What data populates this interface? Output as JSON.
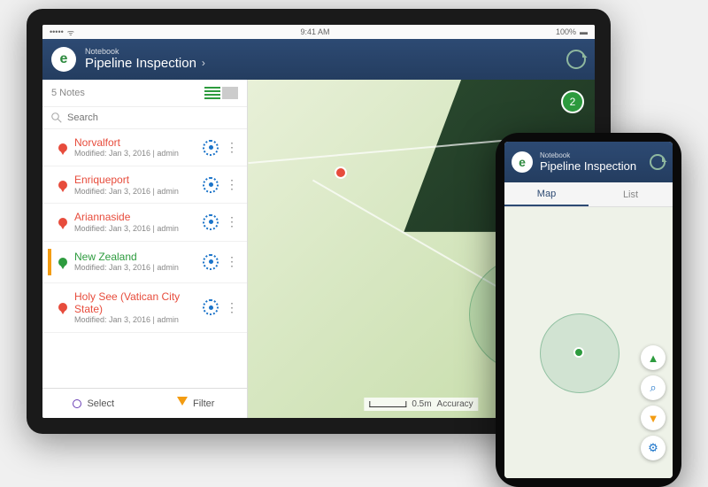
{
  "statusbar": {
    "time": "9:41 AM",
    "battery": "100%"
  },
  "header": {
    "notebook_label": "Notebook",
    "title": "Pipeline Inspection"
  },
  "sidebar": {
    "notes_count": "5 Notes",
    "search_placeholder": "Search",
    "items": [
      {
        "title": "Norvalfort",
        "meta": "Modified: Jan 3, 2016 | admin",
        "color": "#e74c3c",
        "bar": false
      },
      {
        "title": "Enriqueport",
        "meta": "Modified: Jan 3, 2016 | admin",
        "color": "#e74c3c",
        "bar": false
      },
      {
        "title": "Ariannaside",
        "meta": "Modified: Jan 3, 2016 | admin",
        "color": "#e74c3c",
        "bar": false
      },
      {
        "title": "New Zealand",
        "meta": "Modified: Jan 3, 2016 | admin",
        "color": "#2d9b3e",
        "bar": true
      },
      {
        "title": "Holy See (Vatican City State)",
        "meta": "Modified: Jan 3, 2016 | admin",
        "color": "#e74c3c",
        "bar": false
      }
    ],
    "footer": {
      "select": "Select",
      "filter": "Filter"
    }
  },
  "map": {
    "badge": "2",
    "scale": "0.5m",
    "accuracy": "Accuracy"
  },
  "phone": {
    "header": {
      "notebook_label": "Notebook",
      "title": "Pipeline Inspection"
    },
    "tabs": {
      "map": "Map",
      "list": "List"
    }
  },
  "colors": {
    "red": "#e74c3c",
    "orange": "#f39c12",
    "green": "#2d9b3e",
    "blue": "#1a73c9",
    "purple": "#6a3fb5",
    "navy": "#2d4a73"
  }
}
